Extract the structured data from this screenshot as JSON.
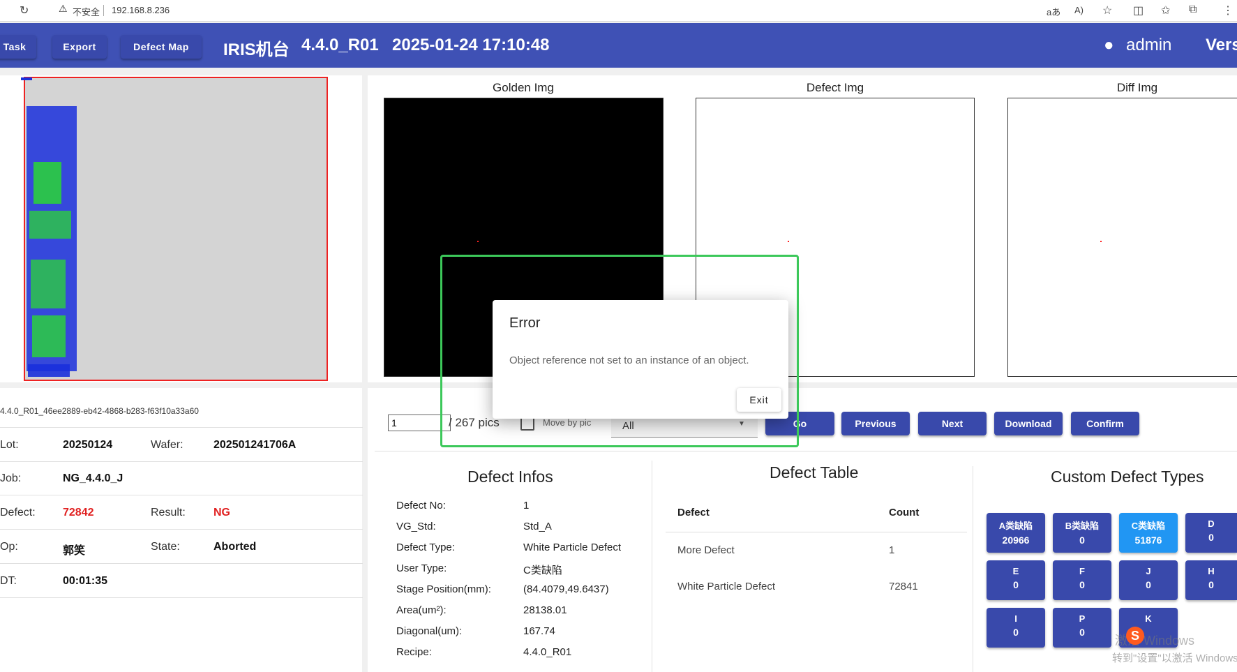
{
  "browser": {
    "security_warning": "不安全",
    "url": "192.168.8.236"
  },
  "appbar": {
    "buttons": [
      "Task",
      "Export",
      "Defect Map"
    ],
    "title": "IRIS机台",
    "version": "4.4.0_R01",
    "datetime": "2025-01-24 17:10:48",
    "user": "admin",
    "right_cut": "Vers"
  },
  "images": {
    "golden_title": "Golden Img",
    "defect_title": "Defect Img",
    "diff_title": "Diff Img"
  },
  "wafer_info": {
    "id": "4.4.0_R01_46ee2889-eb42-4868-b283-f63f10a33a60",
    "lot_label": "Lot:",
    "lot": "20250124",
    "wafer_label": "Wafer:",
    "wafer": "202501241706A",
    "job_label": "Job:",
    "job": "NG_4.4.0_J",
    "defect_label": "Defect:",
    "defect": "72842",
    "result_label": "Result:",
    "result": "NG",
    "op_label": "Op:",
    "op": "郭笑",
    "state_label": "State:",
    "state": "Aborted",
    "dt_label": "DT:",
    "dt": "00:01:35"
  },
  "nav": {
    "page_value": "1",
    "total": "/ 267 pics",
    "move_by_pic": "Move by pic",
    "filter_value": "All",
    "go": "Go",
    "previous": "Previous",
    "next": "Next",
    "download": "Download",
    "confirm": "Confirm"
  },
  "defect_infos": {
    "title": "Defect Infos",
    "rows": [
      {
        "label": "Defect No:",
        "value": "1"
      },
      {
        "label": "VG_Std:",
        "value": "Std_A"
      },
      {
        "label": "Defect Type:",
        "value": "White Particle Defect"
      },
      {
        "label": "User Type:",
        "value": "C类缺陷"
      },
      {
        "label": "Stage Position(mm):",
        "value": "(84.4079,49.6437)"
      },
      {
        "label": "Area(um²):",
        "value": "28138.01"
      },
      {
        "label": "Diagonal(um):",
        "value": "167.74"
      },
      {
        "label": "Recipe:",
        "value": "4.4.0_R01"
      }
    ]
  },
  "defect_table": {
    "title": "Defect Table",
    "col_defect": "Defect",
    "col_count": "Count",
    "rows": [
      {
        "defect": "More Defect",
        "count": "1"
      },
      {
        "defect": "White Particle Defect",
        "count": "72841"
      }
    ]
  },
  "custom_types": {
    "title": "Custom Defect Types",
    "buttons": [
      {
        "name": "A类缺陷",
        "count": "20966"
      },
      {
        "name": "B类缺陷",
        "count": "0"
      },
      {
        "name": "C类缺陷",
        "count": "51876"
      },
      {
        "name": "D",
        "count": "0"
      },
      {
        "name": "E",
        "count": "0"
      },
      {
        "name": "F",
        "count": "0"
      },
      {
        "name": "J",
        "count": "0"
      },
      {
        "name": "H",
        "count": "0"
      },
      {
        "name": "I",
        "count": "0"
      },
      {
        "name": "P",
        "count": "0"
      },
      {
        "name": "K",
        "count": ""
      }
    ]
  },
  "dialog": {
    "title": "Error",
    "message": "Object reference not set to an instance of an object.",
    "exit": "Exit"
  },
  "watermark": {
    "line1": "激活 Windows",
    "line2": "转到\"设置\"以激活 Windows"
  },
  "colors": {
    "primary": "#3f51b5",
    "button": "#3949ab",
    "highlight": "#2196f3",
    "error_red": "#e02020",
    "annotation_green": "#3cc85a"
  }
}
